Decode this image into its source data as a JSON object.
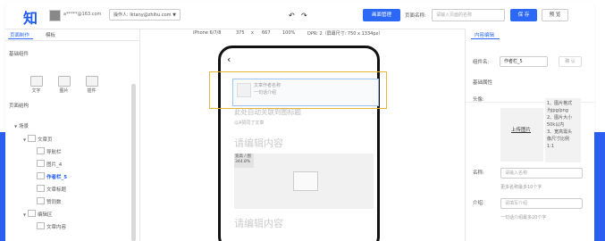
{
  "header": {
    "logo": "知",
    "account": "a*****@163.com",
    "operator": "操作人: lktany@zhihu.com",
    "operator_caret": "▼",
    "publish_label": "画面管理",
    "page_name_label": "页面名称:",
    "page_name_placeholder": "请输入页面的名称",
    "save_label": "保 存",
    "preview_label": "预 览"
  },
  "left_panel": {
    "tabs": [
      "页面制作",
      "模板"
    ],
    "basic_title": "基础组件",
    "components": [
      "文字",
      "图片",
      "插件"
    ],
    "structure_title": "页面结构",
    "tree": [
      {
        "label": "场景",
        "indent": 0,
        "tri": "▼",
        "box": false,
        "active": false
      },
      {
        "label": "文章页",
        "indent": 1,
        "tri": "▼",
        "box": true,
        "active": false
      },
      {
        "label": "导航栏",
        "indent": 2,
        "tri": "",
        "box": true,
        "active": false
      },
      {
        "label": "图片_4",
        "indent": 2,
        "tri": "",
        "box": true,
        "active": false
      },
      {
        "label": "作者栏_5",
        "indent": 2,
        "tri": "",
        "box": true,
        "active": true
      },
      {
        "label": "文章标题",
        "indent": 2,
        "tri": "",
        "box": true,
        "active": false
      },
      {
        "label": "赞同数",
        "indent": 2,
        "tri": "",
        "box": true,
        "active": false
      },
      {
        "label": "编辑区",
        "indent": 1,
        "tri": "▼",
        "box": true,
        "active": false
      },
      {
        "label": "文章内容",
        "indent": 2,
        "tri": "",
        "box": true,
        "active": false
      }
    ]
  },
  "canvas_toolbar": {
    "device": "iPhone 6/7/8",
    "width": "375",
    "x": "x",
    "height": "667",
    "zoom": "100%",
    "dpr": "DPR: 2（屏幕尺寸: 750 x 1334px）",
    "undo": "↶",
    "redo": "↷"
  },
  "phone": {
    "back": "‹",
    "author_name": "文章作者名称",
    "author_intro": "一句话介绍",
    "title": "此处自动关联到图标题",
    "subtitle": "以A赞同了文章",
    "content_placeholder": "请编辑内容",
    "image_tag": "宽高 / 图 344.8%",
    "content_placeholder2": "请编辑内容"
  },
  "right_panel": {
    "tab": "内容编辑",
    "component_name_label": "组件名:",
    "component_name_value": "作者栏_5",
    "confirm_label": "确 认",
    "basic_attrs": "基础属性",
    "avatar_label": "头像:",
    "upload_label": "上传图片",
    "hint": "1、图片格式\n为jpg/png\n2、图片大小\n50k以内\n3、宽高需头\n像尺寸比例\n1:1",
    "name_label": "名称:",
    "name_placeholder": "请输入名称",
    "name_note": "更多名称最多10个字",
    "intro_label": "介绍:",
    "intro_placeholder": "请填写介绍",
    "intro_note": "一句话介绍最多20个字"
  }
}
